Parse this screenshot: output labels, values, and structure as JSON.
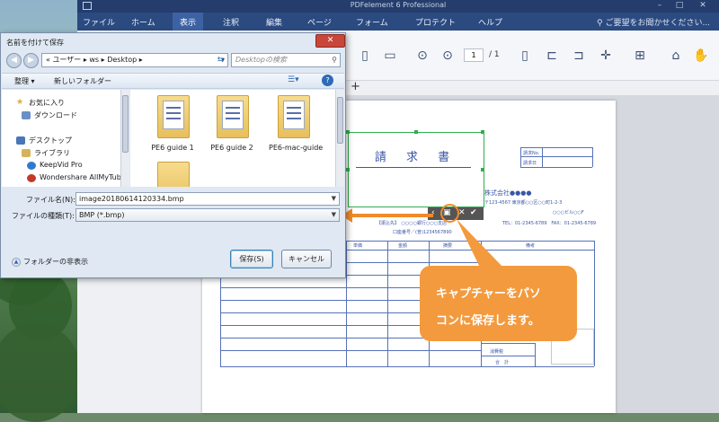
{
  "app": {
    "title": "PDFelement 6 Professional",
    "menu": [
      "ファイル",
      "ホーム",
      "表示",
      "注釈",
      "編集",
      "ページ",
      "フォーム",
      "プロテクト",
      "ヘルプ"
    ],
    "active_menu": "表示",
    "search_placeholder": "ご要望をお聞かせください...",
    "page_current": "1",
    "page_total": "/ 1"
  },
  "document": {
    "title": "請 求 書",
    "fields": [
      "請求No.",
      "請求日"
    ],
    "company": "株式会社●●●●",
    "address": "〒123-4567 東京都○○区○○町1-2-3",
    "building": "○○○ビル○○F",
    "phone": "TEL：01-2345-6789　FAX：01-2345-6789",
    "bank": "【振込先】　○○○○銀行○○○支店",
    "account": "口座番号／(普)1234567890",
    "columns": [
      "単価",
      "金額",
      "摘要",
      "備考"
    ],
    "tax_label": "消費税",
    "total_label": "合　計"
  },
  "dialog": {
    "title": "名前を付けて保存",
    "close": "✕",
    "breadcrumb": "« ユーザー ▸ ws ▸ Desktop ▸",
    "search_placeholder": "Desktopの検索",
    "organize": "整理 ▾",
    "new_folder": "新しいフォルダー",
    "nav": {
      "favorites": "お気に入り",
      "downloads": "ダウンロード",
      "desktop": "デスクトップ",
      "libraries": "ライブラリ",
      "keepvid": "KeepVid Pro",
      "wondershare": "Wondershare AllMyTube"
    },
    "folders": [
      "PE6 guide 1",
      "PE6 guide 2",
      "PE6-mac-guide"
    ],
    "filename_label": "ファイル名(N):",
    "filename_value": "image20180614120334.bmp",
    "filetype_label": "ファイルの種類(T):",
    "filetype_value": "BMP (*.bmp)",
    "hide_folders": "フォルダーの非表示",
    "save": "保存(S)",
    "cancel": "キャンセル"
  },
  "callout": {
    "line1": "キャプチャーをパソ",
    "line2": "コンに保存します。"
  },
  "colors": {
    "accent": "#f39a3e",
    "menubar": "#2b4a80",
    "capture_border": "#2fae4f",
    "doc_blue": "#3a57a8"
  }
}
